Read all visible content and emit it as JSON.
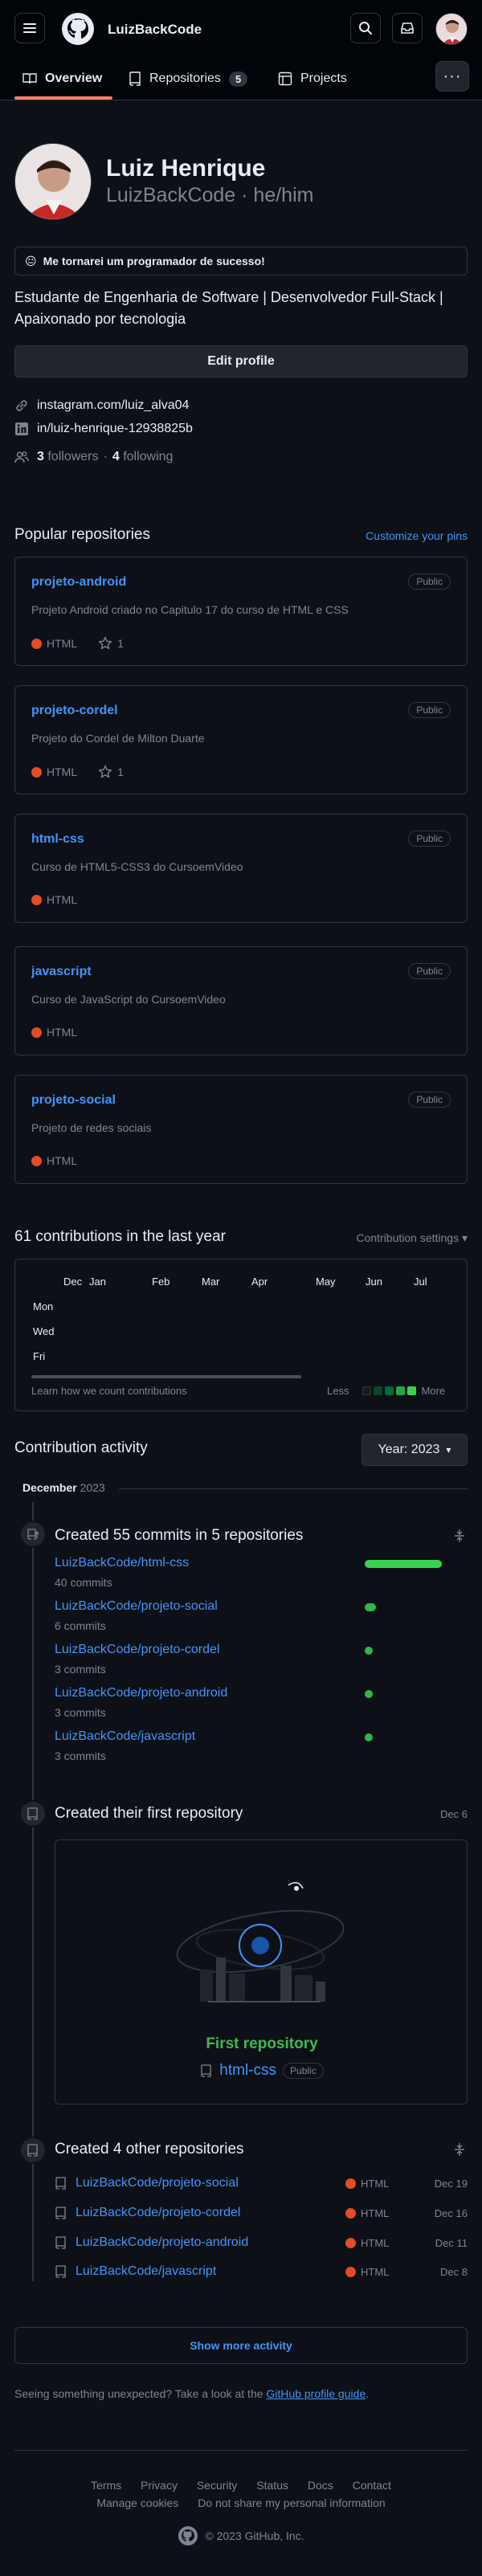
{
  "header": {
    "brand": "LuizBackCode",
    "tabs": [
      {
        "label": "Overview"
      },
      {
        "label": "Repositories",
        "count": "5"
      },
      {
        "label": "Projects"
      }
    ],
    "more_label": "···"
  },
  "profile": {
    "name": "Luiz Henrique",
    "login_line": "LuizBackCode · he/him",
    "status_emoji": "😐",
    "status_text": "Me tornarei um programador de sucesso!",
    "bio": "Estudante de Engenharia de Software | Desenvolvedor Full-Stack | Apaixonado por tecnologia",
    "edit_label": "Edit profile",
    "instagram": "instagram.com/luiz_alva04",
    "linkedin": "in/luiz-henrique-12938825b",
    "followers_count": "3",
    "followers_label": "followers",
    "separator": "·",
    "following_count": "4",
    "following_label": "following"
  },
  "popular": {
    "title": "Popular repositories",
    "customize": "Customize your pins",
    "repos": [
      {
        "name": "projeto-android",
        "visibility": "Public",
        "desc": "Projeto Android criado no Capitulo 17 do curso de HTML e CSS",
        "lang": "HTML",
        "stars": "1"
      },
      {
        "name": "projeto-cordel",
        "visibility": "Public",
        "desc": "Projeto do Cordel de Milton Duarte",
        "lang": "HTML",
        "stars": "1"
      },
      {
        "name": "html-css",
        "visibility": "Public",
        "desc": "Curso de HTML5-CSS3 do CursoemVideo",
        "lang": "HTML",
        "stars": ""
      },
      {
        "name": "javascript",
        "visibility": "Public",
        "desc": "Curso de JavaScript do CursoemVideo",
        "lang": "HTML",
        "stars": ""
      },
      {
        "name": "projeto-social",
        "visibility": "Public",
        "desc": "Projeto de redes sociais",
        "lang": "HTML",
        "stars": ""
      }
    ]
  },
  "contributions": {
    "title": "61 contributions in the last year",
    "settings": "Contribution settings ▾",
    "months": [
      "Dec",
      "Jan",
      "Feb",
      "Mar",
      "Apr",
      "May",
      "Jun",
      "Jul"
    ],
    "days": [
      "Mon",
      "Wed",
      "Fri"
    ],
    "learn": "Learn how we count contributions",
    "less": "Less",
    "more": "More",
    "legend_colors": [
      "#161b22",
      "#0e4429",
      "#006d32",
      "#26a641",
      "#39d353"
    ]
  },
  "activity": {
    "title": "Contribution activity",
    "year_label": "Year: 2023",
    "month": "December",
    "month_year": "2023",
    "commits_title": "Created 55 commits in 5 repositories",
    "commits": [
      {
        "repo": "LuizBackCode/html-css",
        "count": "40 commits",
        "value": 40
      },
      {
        "repo": "LuizBackCode/projeto-social",
        "count": "6 commits",
        "value": 6
      },
      {
        "repo": "LuizBackCode/projeto-cordel",
        "count": "3 commits",
        "value": 3
      },
      {
        "repo": "LuizBackCode/projeto-android",
        "count": "3 commits",
        "value": 3
      },
      {
        "repo": "LuizBackCode/javascript",
        "count": "3 commits",
        "value": 3
      }
    ],
    "first_title": "Created their first repository",
    "first_date": "Dec 6",
    "first_label": "First repository",
    "first_repo": "html-css",
    "first_visibility": "Public",
    "other_title": "Created 4 other repositories",
    "others": [
      {
        "repo": "LuizBackCode/projeto-social",
        "lang": "HTML",
        "date": "Dec 19"
      },
      {
        "repo": "LuizBackCode/projeto-cordel",
        "lang": "HTML",
        "date": "Dec 16"
      },
      {
        "repo": "LuizBackCode/projeto-android",
        "lang": "HTML",
        "date": "Dec 11"
      },
      {
        "repo": "LuizBackCode/javascript",
        "lang": "HTML",
        "date": "Dec 8"
      }
    ],
    "show_more": "Show more activity",
    "unexpected": "Seeing something unexpected? Take a look at the ",
    "guide_link": "GitHub profile guide",
    "guide_end": "."
  },
  "footer": {
    "row1": [
      "Terms",
      "Privacy",
      "Security",
      "Status",
      "Docs",
      "Contact"
    ],
    "row2": [
      "Manage cookies",
      "Do not share my personal information"
    ],
    "copyright": "© 2023 GitHub, Inc."
  },
  "colors": {
    "accent": "#4493f8",
    "html": "#e34c26",
    "green": "#39d353",
    "tab_underline": "#f78166"
  }
}
